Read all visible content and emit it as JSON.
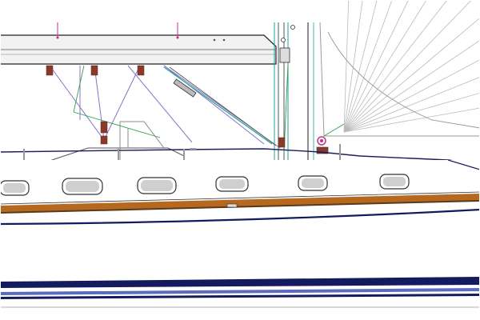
{
  "drawing": {
    "subject": "sailboat-profile-cad-drawing",
    "text_labels": []
  },
  "colors": {
    "background": "#ffffff",
    "hull_outline": "#1c1f5c",
    "boot_stripe": "#b5681e",
    "boot_stripe_dark": "#5a3a1a",
    "waterline_navy": "#141a5e",
    "lower_stripe_blue": "#5a6cc0",
    "rigging_purple": "#8a74c4",
    "rigging_magenta": "#c2358f",
    "line_teal": "#1ea39a",
    "line_green": "#2f9e4a",
    "bimini_fill": "#f2f2f2",
    "deck_gray": "#8a8a8a",
    "portlight_fill": "#cfcfcf",
    "sail_lines": "#b9b9b9",
    "fitting_brown": "#8b3a2a"
  },
  "icons": [
    "bimini-top",
    "mast",
    "boom",
    "portlight",
    "turnbuckle",
    "stanchion",
    "winch"
  ]
}
